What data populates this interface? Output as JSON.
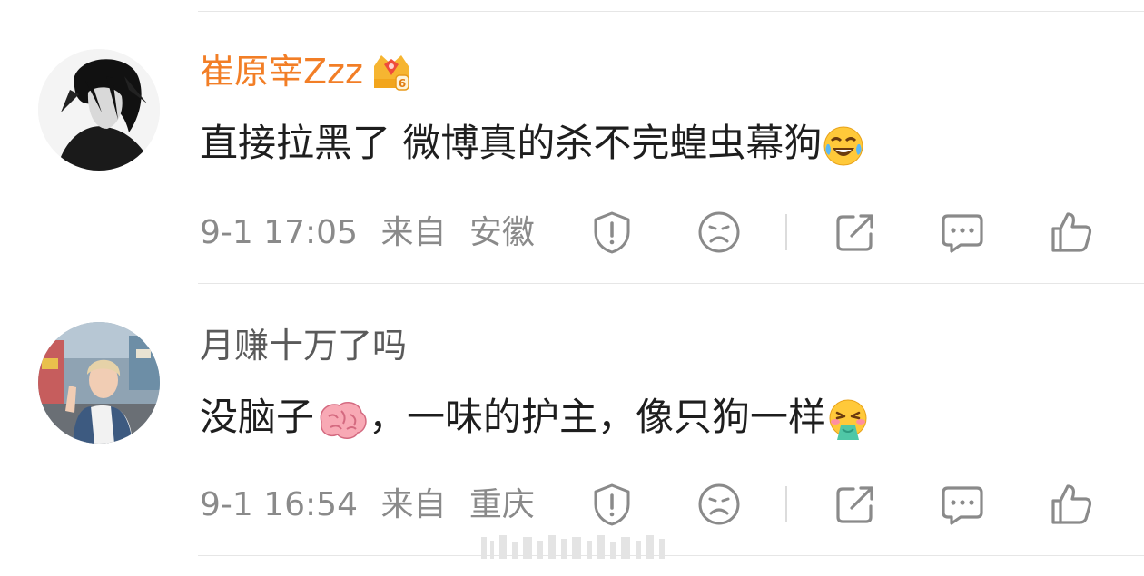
{
  "comments": [
    {
      "username": "崔原宰Zzz",
      "content": "直接拉黑了 微博真的杀不完蝗虫幕狗",
      "time": "9-1 17:05",
      "source_prefix": "来自",
      "region": "安徽",
      "content_emoji": "laugh-cry-emoji-icon",
      "badge_icon": "crown-badge-icon",
      "badge_level": "6"
    },
    {
      "username": "月赚十万了吗",
      "content_before": "没脑子",
      "content_after": "，一味的护主，像只狗一样",
      "time": "9-1 16:54",
      "source_prefix": "来自",
      "region": "重庆",
      "content_emoji_1": "brain-emoji-icon",
      "content_emoji_2": "vomit-emoji-icon"
    }
  ],
  "colors": {
    "username_vip": "#f27e26",
    "username_normal": "#5a5a5a",
    "meta_gray": "#8a8a8a",
    "icon_gray": "#8a8a8a"
  }
}
